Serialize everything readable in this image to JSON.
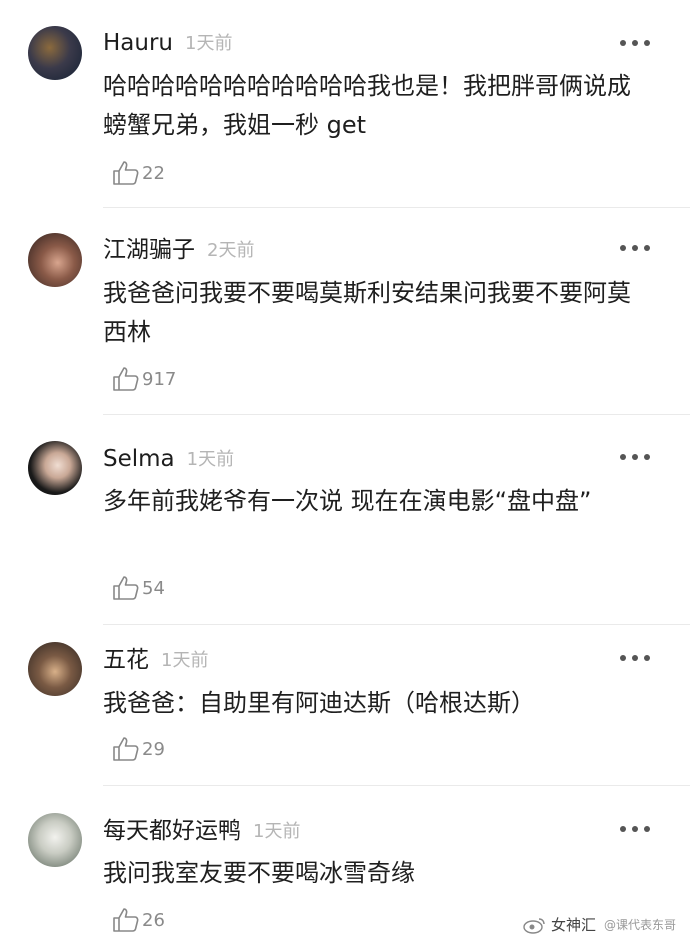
{
  "comments": [
    {
      "name": "Hauru",
      "time": "1天前",
      "text": "哈哈哈哈哈哈哈哈哈哈哈我也是！我把胖哥俩说成螃蟹兄弟，我姐一秒 get",
      "likes": "22",
      "avatar_colors": [
        "#1b2a3a",
        "#6a4d2b"
      ]
    },
    {
      "name": "江湖骗子",
      "time": "2天前",
      "text": "我爸爸问我要不要喝莫斯利安结果问我要不要阿莫西林",
      "likes": "917",
      "avatar_colors": [
        "#3a2a24",
        "#c79a84"
      ]
    },
    {
      "name": "Selma",
      "time": "1天前",
      "text": "多年前我姥爷有一次说 现在在演电影“盘中盘”",
      "likes": "54",
      "avatar_colors": [
        "#0e0e0e",
        "#e9d7cf"
      ]
    },
    {
      "name": "五花",
      "time": "1天前",
      "text": "我爸爸：自助里有阿迪达斯（哈根达斯）",
      "likes": "29",
      "avatar_colors": [
        "#4b3a30",
        "#caa27c"
      ]
    },
    {
      "name": "每天都好运鸭",
      "time": "1天前",
      "text": "我问我室友要不要喝冰雪奇缘",
      "likes": "26",
      "avatar_colors": [
        "#5e6a5d",
        "#e7e7e2"
      ]
    }
  ],
  "watermark": {
    "label": "女神汇",
    "sub": "@课代表东哥"
  },
  "icons": {
    "like": "thumbs-up-icon",
    "more": "more-dots-icon"
  }
}
